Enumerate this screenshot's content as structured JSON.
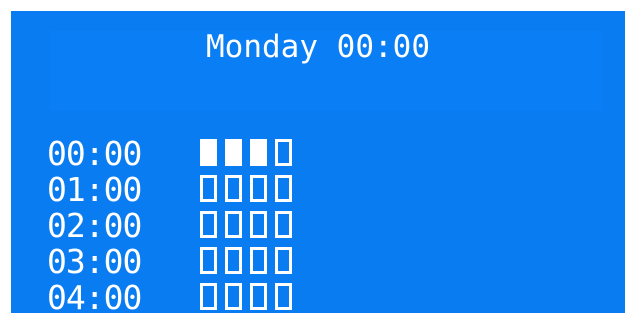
{
  "colors": {
    "screen_background": "#0a7cf2",
    "foreground": "#ffffff"
  },
  "header": {
    "title": "Monday 00:00"
  },
  "schedule": {
    "rows": [
      {
        "time": "00:00",
        "slots": [
          true,
          true,
          true,
          false
        ]
      },
      {
        "time": "01:00",
        "slots": [
          false,
          false,
          false,
          false
        ]
      },
      {
        "time": "02:00",
        "slots": [
          false,
          false,
          false,
          false
        ]
      },
      {
        "time": "03:00",
        "slots": [
          false,
          false,
          false,
          false
        ]
      },
      {
        "time": "04:00",
        "slots": [
          false,
          false,
          false,
          false
        ]
      }
    ]
  }
}
